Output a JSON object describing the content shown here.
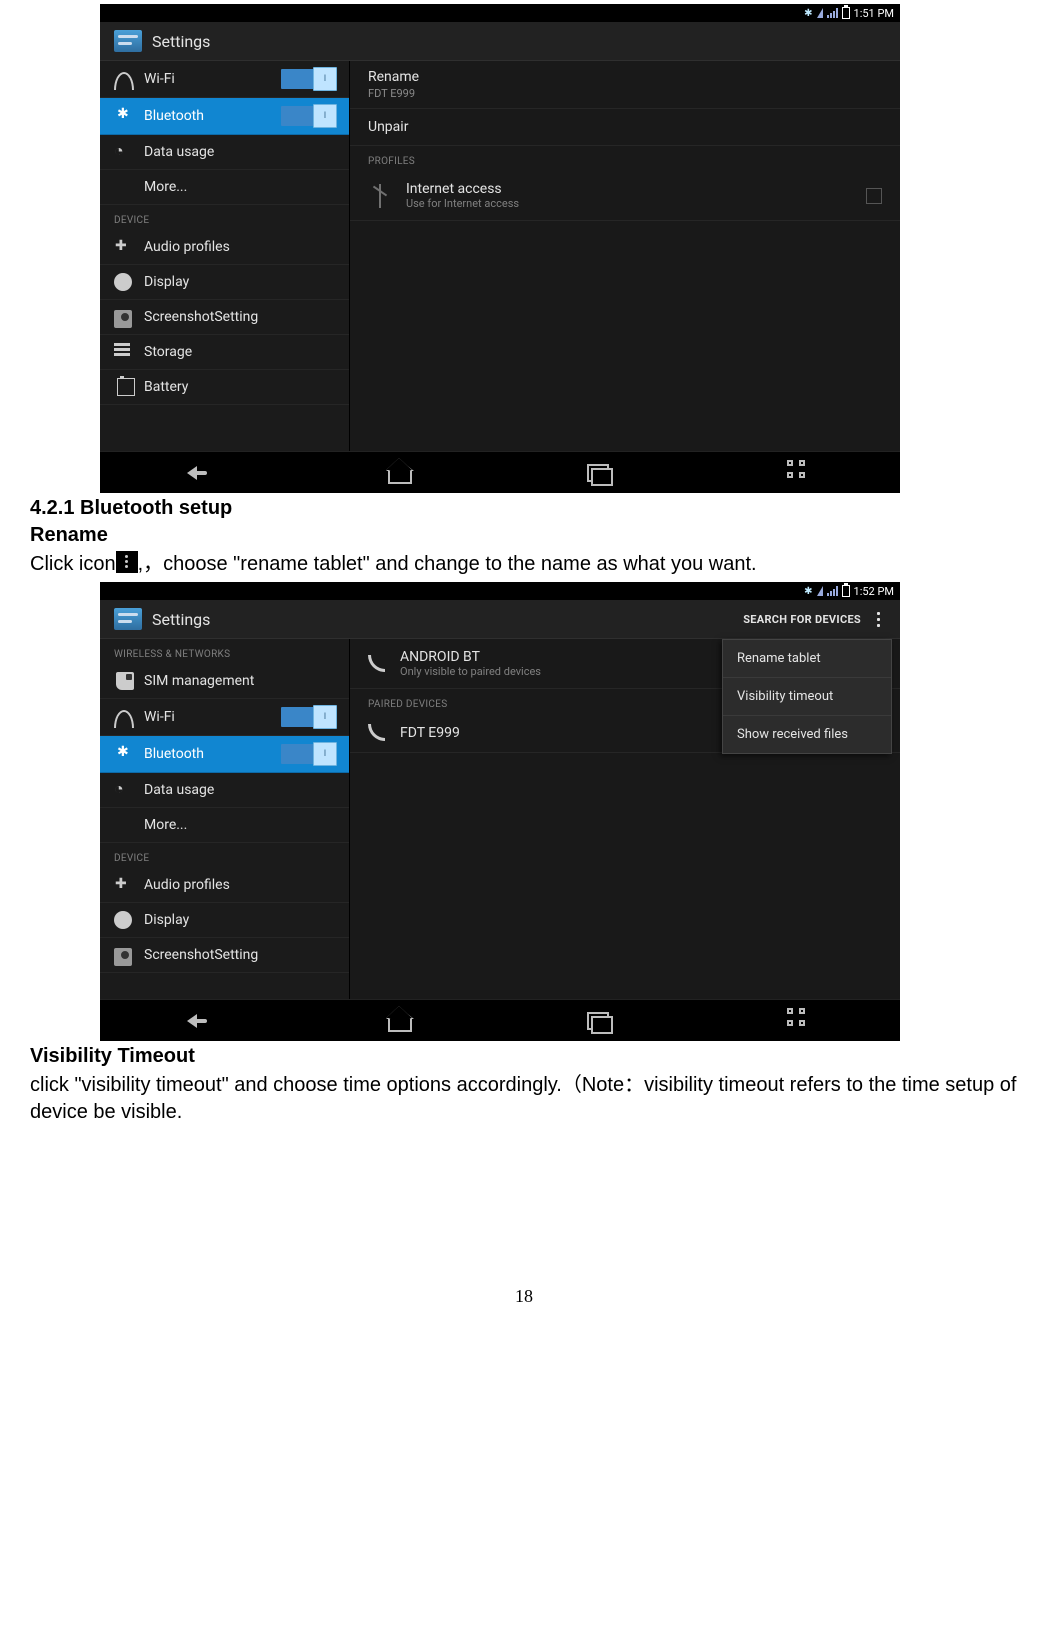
{
  "page_number": "18",
  "text": {
    "h1": "4.2.1 Bluetooth setup",
    "sub_rename": "Rename",
    "rename_body_a": "Click icon",
    "rename_body_b": ",，choose \"rename tablet\" and change to the name as what you want.",
    "sub_vis": "Visibility Timeout",
    "vis_body": "click \"visibility timeout\" and choose time options accordingly.（Note：visibility timeout refers to the time setup of device be visible."
  },
  "shot1": {
    "clock": "1:51 PM",
    "title": "Settings",
    "sidebar_head_device": "DEVICE",
    "wifi": "Wi-Fi",
    "bluetooth": "Bluetooth",
    "data": "Data usage",
    "more": "More...",
    "audio": "Audio profiles",
    "display": "Display",
    "screenshot": "ScreenshotSetting",
    "storage": "Storage",
    "battery": "Battery",
    "toggle_on": "I",
    "rename": "Rename",
    "rename_sub": "FDT E999",
    "unpair": "Unpair",
    "profiles": "PROFILES",
    "internet_t": "Internet access",
    "internet_s": "Use for Internet access"
  },
  "shot2": {
    "clock": "1:52 PM",
    "title": "Settings",
    "search": "SEARCH FOR DEVICES",
    "head_wn": "WIRELESS & NETWORKS",
    "head_device": "DEVICE",
    "sim": "SIM management",
    "wifi": "Wi-Fi",
    "bluetooth": "Bluetooth",
    "data": "Data usage",
    "more": "More...",
    "audio": "Audio profiles",
    "display": "Display",
    "screenshot": "ScreenshotSetting",
    "toggle_on": "I",
    "bt_name": "ANDROID BT",
    "bt_sub": "Only visible to paired devices",
    "paired": "PAIRED DEVICES",
    "paired_dev": "FDT E999",
    "pop1": "Rename tablet",
    "pop2": "Visibility timeout",
    "pop3": "Show received files"
  }
}
